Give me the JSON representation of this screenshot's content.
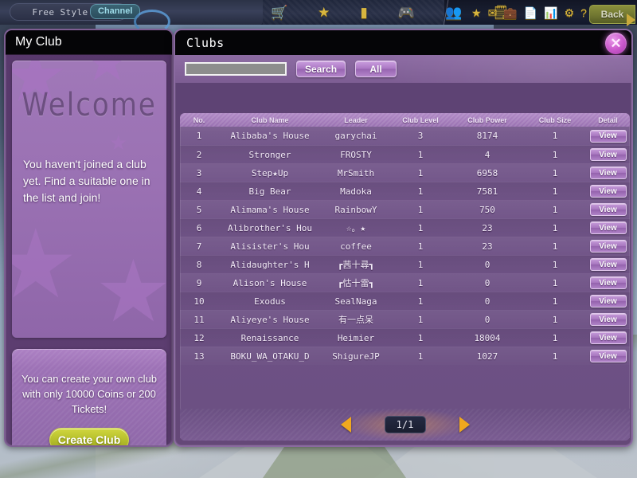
{
  "topbar": {
    "server_label": "Free Style 01",
    "channel_label": "Channel",
    "back_label": "Back",
    "icons_left": [
      "cart-icon",
      "star-icon",
      "bar-chart-icon",
      "gamepad-icon",
      "people-icon",
      "notepad-icon"
    ],
    "icons_right": [
      "star-icon",
      "mail-icon",
      "briefcase-icon",
      "document-icon",
      "chart-icon",
      "gear-icon",
      "help-icon"
    ],
    "glyphs_left": [
      "🛒",
      "★",
      "▮",
      "🎮",
      "👥",
      "🗒"
    ],
    "glyphs_right": [
      "★",
      "✉",
      "💼",
      "📄",
      "📊",
      "⚙",
      "?"
    ]
  },
  "left_panel": {
    "title": "My Club",
    "welcome_word": "Welcome",
    "welcome_message": "You haven't joined a club yet. Find a suitable one in the list and join!",
    "create_text": "You can create your own club with only 10000 Coins or 200 Tickets!",
    "create_button": "Create Club"
  },
  "clubs_panel": {
    "title": "Clubs",
    "close_glyph": "✕",
    "search_value": "",
    "search_placeholder": "",
    "search_button": "Search",
    "all_button": "All",
    "columns": [
      "No.",
      "Club Name",
      "Leader",
      "Club Level",
      "Club Power",
      "Club Size",
      "Detail"
    ],
    "detail_button": "View",
    "rows": [
      {
        "no": "1",
        "name": "Alibaba's House",
        "leader": "garychai",
        "level": "3",
        "power": "8174",
        "size": "1"
      },
      {
        "no": "2",
        "name": "Stronger",
        "leader": "FROSTY",
        "level": "1",
        "power": "4",
        "size": "1"
      },
      {
        "no": "3",
        "name": "Step★Up",
        "leader": "MrSmith",
        "level": "1",
        "power": "6958",
        "size": "1"
      },
      {
        "no": "4",
        "name": "Big Bear",
        "leader": "Madoka",
        "level": "1",
        "power": "7581",
        "size": "1"
      },
      {
        "no": "5",
        "name": "Alimama's House",
        "leader": "RainbowY",
        "level": "1",
        "power": "750",
        "size": "1"
      },
      {
        "no": "6",
        "name": "Alibrother's Hou",
        "leader": "☆。★",
        "level": "1",
        "power": "23",
        "size": "1"
      },
      {
        "no": "7",
        "name": "Alisister's Hou",
        "leader": "coffee",
        "level": "1",
        "power": "23",
        "size": "1"
      },
      {
        "no": "8",
        "name": "Alidaughter's H",
        "leader": "┏茜十尋┓",
        "level": "1",
        "power": "0",
        "size": "1"
      },
      {
        "no": "9",
        "name": "Alison's House",
        "leader": "┏怙十雷┓",
        "level": "1",
        "power": "0",
        "size": "1"
      },
      {
        "no": "10",
        "name": "Exodus",
        "leader": "SealNaga",
        "level": "1",
        "power": "0",
        "size": "1"
      },
      {
        "no": "11",
        "name": "Aliyeye's House",
        "leader": "有一点呆",
        "level": "1",
        "power": "0",
        "size": "1"
      },
      {
        "no": "12",
        "name": "Renaissance",
        "leader": "Heimier",
        "level": "1",
        "power": "18004",
        "size": "1"
      },
      {
        "no": "13",
        "name": "BOKU_WA_OTAKU_D",
        "leader": "ShigureJP",
        "level": "1",
        "power": "1027",
        "size": "1"
      }
    ],
    "pager": {
      "prev_glyph": "◀",
      "next_glyph": "▶",
      "page_text": "1/1"
    }
  },
  "colors": {
    "panel_purple": "#5d4273",
    "accent_lilac": "#ab78c4",
    "close_magenta": "#cf5fd0",
    "create_green": "#b9c22d",
    "pager_orange": "#f0a81e",
    "topbar_gold": "#d8b63f"
  }
}
